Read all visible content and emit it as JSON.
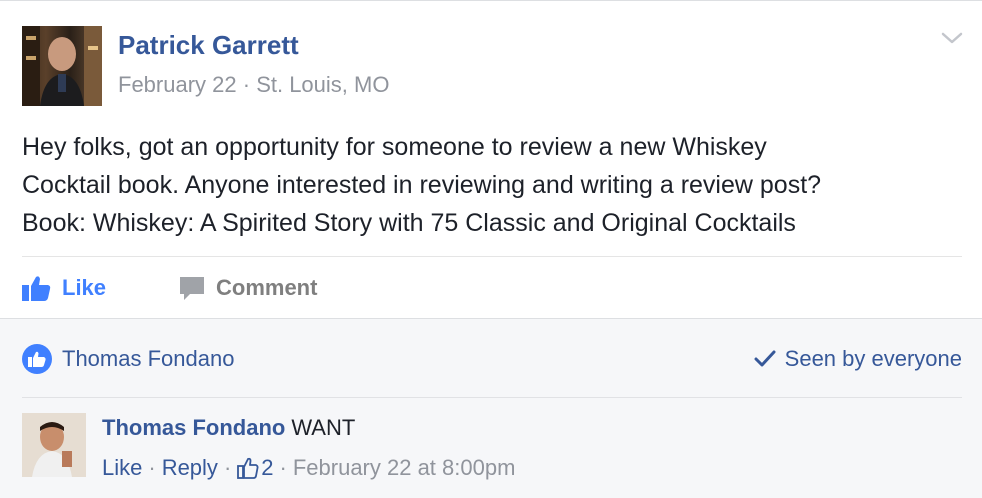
{
  "post": {
    "author": "Patrick Garrett",
    "date": "February 22",
    "location": "St. Louis, MO",
    "meta_separator": " · ",
    "text_lines": [
      "Hey folks, got an opportunity for someone to review a new Whiskey",
      "Cocktail book.  Anyone interested in reviewing and writing a review post?",
      "Book: Whiskey: A Spirited Story with 75 Classic and Original Cocktails"
    ]
  },
  "actions": {
    "like_label": "Like",
    "comment_label": "Comment"
  },
  "likes": {
    "liker_name": "Thomas Fondano",
    "seen_label": "Seen by everyone"
  },
  "comment": {
    "author": "Thomas Fondano",
    "text": "WANT",
    "like_label": "Like",
    "reply_label": "Reply",
    "like_count": "2",
    "timestamp": "February 22 at 8:00pm"
  },
  "colors": {
    "link_blue": "#365899",
    "accent_blue": "#4080ff",
    "muted_gray": "#90949c",
    "footer_bg": "#f6f7f9"
  }
}
